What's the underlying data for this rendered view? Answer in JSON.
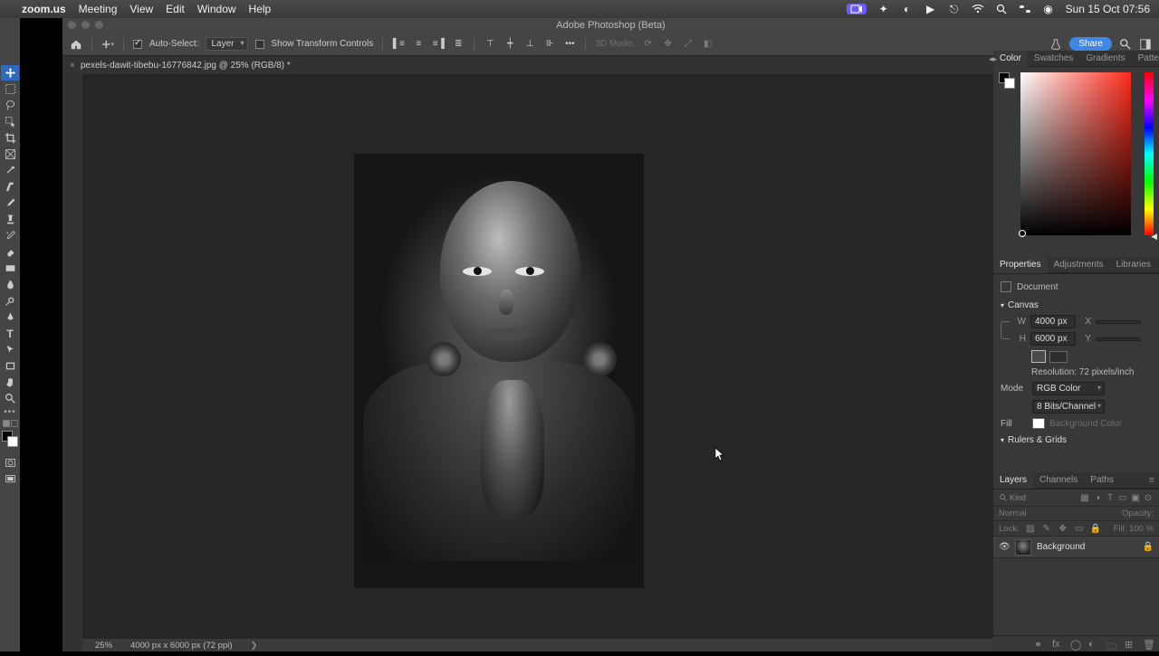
{
  "menubar": {
    "app": "zoom.us",
    "items": [
      "Meeting",
      "View",
      "Edit",
      "Window",
      "Help"
    ],
    "clock": "Sun 15 Oct  07:56"
  },
  "app": {
    "title": "Adobe Photoshop (Beta)"
  },
  "options_bar": {
    "auto_select_label": "Auto-Select:",
    "auto_select_value": "Layer",
    "show_transform_label": "Show Transform Controls",
    "mode_label": "3D Mode:",
    "share_label": "Share"
  },
  "doc_tab": {
    "title": "pexels-dawit-tibebu-16776842.jpg @ 25% (RGB/8) *"
  },
  "status": {
    "zoom": "25%",
    "dims": "4000 px x 6000 px (72 ppi)"
  },
  "color_panel": {
    "tabs": [
      "Color",
      "Swatches",
      "Gradients",
      "Patterns"
    ]
  },
  "properties_panel": {
    "tabs": [
      "Properties",
      "Adjustments",
      "Libraries"
    ],
    "doc_label": "Document",
    "canvas_label": "Canvas",
    "w_label": "W",
    "w_value": "4000 px",
    "h_label": "H",
    "h_value": "6000 px",
    "x_label": "X",
    "y_label": "Y",
    "resolution_label": "Resolution: 72 pixels/inch",
    "mode_label": "Mode",
    "mode_value": "RGB Color",
    "depth_value": "8 Bits/Channel",
    "fill_label": "Fill",
    "fill_color_label": "Background Color",
    "rulers_label": "Rulers & Grids"
  },
  "layers_panel": {
    "tabs": [
      "Layers",
      "Channels",
      "Paths"
    ],
    "kind_label": "Kind",
    "blend_mode": "Normal",
    "opacity_label": "Opacity:",
    "lock_label": "Lock:",
    "fill_label": "Fill: 100 %",
    "layer0": {
      "name": "Background"
    }
  }
}
